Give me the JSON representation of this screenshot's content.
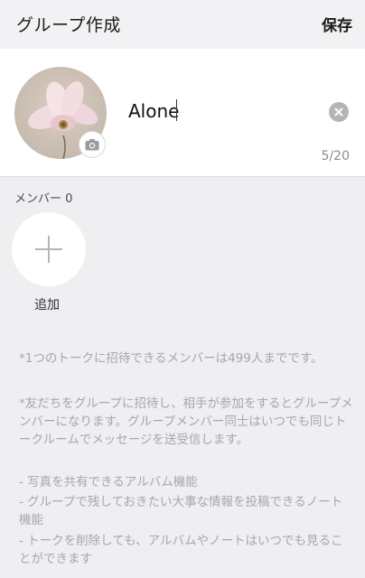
{
  "header": {
    "title": "グループ作成",
    "save_label": "保存"
  },
  "group": {
    "name_value": "Alone",
    "char_count": "5/20"
  },
  "members": {
    "label": "メンバー 0",
    "add_label": "追加"
  },
  "notes": {
    "limit": "*1つのトークに招待できるメンバーは499人までです。",
    "invite": "*友だちをグループに招待し、相手が参加をするとグループメンバーになります。グループメンバー同士はいつでも同じトークルームでメッセージを送受信します。",
    "features": [
      "- 写真を共有できるアルバム機能",
      "- グループで残しておきたい大事な情報を投稿できるノート機能",
      "- トークを削除しても、アルバムやノートはいつでも見ることができます"
    ]
  }
}
